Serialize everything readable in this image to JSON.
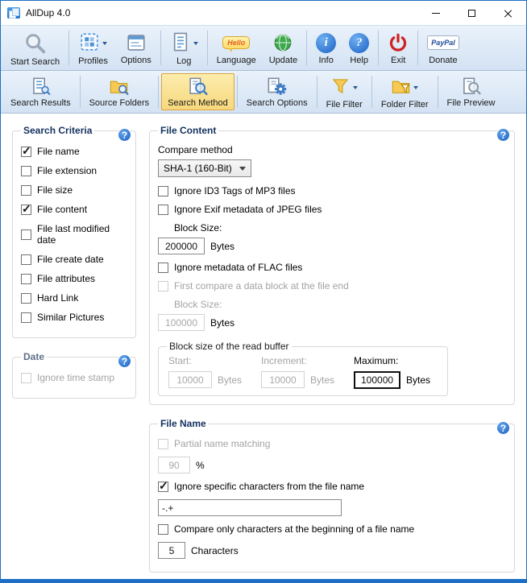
{
  "help_glyph": "?",
  "window": {
    "title": "AllDup 4.0"
  },
  "toolbar": {
    "items": [
      {
        "label": "Start Search"
      },
      {
        "label": "Profiles"
      },
      {
        "label": "Options"
      },
      {
        "label": "Log"
      },
      {
        "label": "Language"
      },
      {
        "label": "Update"
      },
      {
        "label": "Info"
      },
      {
        "label": "Help"
      },
      {
        "label": "Exit"
      },
      {
        "label": "Donate"
      }
    ],
    "hello_text": "Hello",
    "paypal_text": "PayPal",
    "info_glyph": "i",
    "help_glyph": "?"
  },
  "navbar": {
    "items": [
      {
        "label": "Search Results"
      },
      {
        "label": "Source Folders"
      },
      {
        "label": "Search Method"
      },
      {
        "label": "Search Options"
      },
      {
        "label": "File Filter"
      },
      {
        "label": "Folder Filter"
      },
      {
        "label": "File Preview"
      }
    ]
  },
  "search_criteria": {
    "title": "Search Criteria",
    "items": [
      {
        "label": "File name",
        "checked": true
      },
      {
        "label": "File extension",
        "checked": false
      },
      {
        "label": "File size",
        "checked": false
      },
      {
        "label": "File content",
        "checked": true
      },
      {
        "label": "File last modified date",
        "checked": false
      },
      {
        "label": "File create date",
        "checked": false
      },
      {
        "label": "File attributes",
        "checked": false
      },
      {
        "label": "Hard Link",
        "checked": false
      },
      {
        "label": "Similar Pictures",
        "checked": false
      }
    ]
  },
  "date_group": {
    "title": "Date",
    "ignore_time_stamp": {
      "label": "Ignore time stamp",
      "checked": false
    }
  },
  "file_content": {
    "title": "File Content",
    "compare_method_label": "Compare method",
    "compare_method_value": "SHA-1 (160-Bit)",
    "ignore_id3": {
      "label": "Ignore ID3 Tags of MP3 files",
      "checked": false
    },
    "ignore_exif": {
      "label": "Ignore Exif metadata of JPEG files",
      "checked": false
    },
    "block_size_label": "Block Size:",
    "block_size_value": "200000",
    "bytes_label": "Bytes",
    "ignore_flac": {
      "label": "Ignore metadata of FLAC files",
      "checked": false
    },
    "first_compare": {
      "label": "First compare a data block at the file end",
      "checked": false
    },
    "end_block_size_label": "Block Size:",
    "end_block_size_value": "100000",
    "read_buffer": {
      "title": "Block size of the read buffer",
      "start_label": "Start:",
      "start_value": "10000",
      "increment_label": "Increment:",
      "increment_value": "10000",
      "maximum_label": "Maximum:",
      "maximum_value": "100000",
      "bytes_label": "Bytes"
    }
  },
  "file_name": {
    "title": "File Name",
    "partial": {
      "label": "Partial name matching",
      "checked": false
    },
    "partial_value": "90",
    "percent_label": "%",
    "ignore_chars": {
      "label": "Ignore specific characters from the file name",
      "checked": true
    },
    "ignore_chars_value": "-.+",
    "compare_begin": {
      "label": "Compare only characters at the beginning of a file name",
      "checked": false
    },
    "compare_begin_value": "5",
    "characters_label": "Characters"
  }
}
